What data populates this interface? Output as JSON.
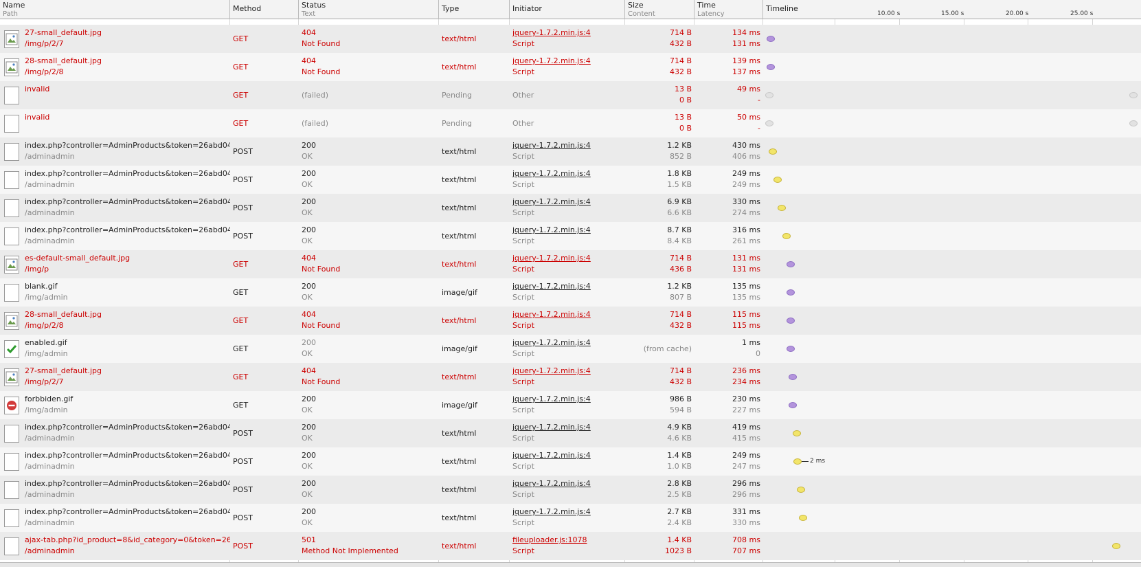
{
  "headers": {
    "name": "Name",
    "path": "Path",
    "method": "Method",
    "status": "Status",
    "text": "Text",
    "type": "Type",
    "initiator": "Initiator",
    "size": "Size",
    "content": "Content",
    "time": "Time",
    "latency": "Latency",
    "timeline": "Timeline"
  },
  "ticks": [
    "10.00 s",
    "15.00 s",
    "20.00 s",
    "25.00 s"
  ],
  "timeline_annotation": "2 ms",
  "rows": [
    {
      "icon": "broken-image-icon",
      "name": "27-small_default.jpg",
      "path": "/img/p/2/7",
      "method": "GET",
      "status": "404",
      "status_text": "Not Found",
      "type": "text/html",
      "initiator": "jquery-1.7.2.min.js:4",
      "initiator_type": "Script",
      "size": "714 B",
      "content": "432 B",
      "time": "134 ms",
      "latency": "131 ms",
      "style": "red",
      "dot": "purple"
    },
    {
      "icon": "broken-image-icon",
      "name": "28-small_default.jpg",
      "path": "/img/p/2/8",
      "method": "GET",
      "status": "404",
      "status_text": "Not Found",
      "type": "text/html",
      "initiator": "jquery-1.7.2.min.js:4",
      "initiator_type": "Script",
      "size": "714 B",
      "content": "432 B",
      "time": "139 ms",
      "latency": "137 ms",
      "style": "red",
      "dot": "purple"
    },
    {
      "icon": "blank-file-icon",
      "name": "invalid",
      "path": "",
      "method": "GET",
      "status": "(failed)",
      "status_text": "",
      "type": "Pending",
      "initiator": "Other",
      "initiator_type": "",
      "size": "13 B",
      "content": "0 B",
      "time": "49 ms",
      "latency": "-",
      "style": "failed",
      "dot": "grey"
    },
    {
      "icon": "blank-file-icon",
      "name": "invalid",
      "path": "",
      "method": "GET",
      "status": "(failed)",
      "status_text": "",
      "type": "Pending",
      "initiator": "Other",
      "initiator_type": "",
      "size": "13 B",
      "content": "0 B",
      "time": "50 ms",
      "latency": "-",
      "style": "failed",
      "dot": "grey"
    },
    {
      "icon": "blank-file-icon",
      "name": "index.php?controller=AdminProducts&token=26abd04...",
      "path": "/adminadmin",
      "method": "POST",
      "status": "200",
      "status_text": "OK",
      "type": "text/html",
      "initiator": "jquery-1.7.2.min.js:4",
      "initiator_type": "Script",
      "size": "1.2 KB",
      "content": "852 B",
      "time": "430 ms",
      "latency": "406 ms",
      "style": "normal",
      "dot": "yellow"
    },
    {
      "icon": "blank-file-icon",
      "name": "index.php?controller=AdminProducts&token=26abd04...",
      "path": "/adminadmin",
      "method": "POST",
      "status": "200",
      "status_text": "OK",
      "type": "text/html",
      "initiator": "jquery-1.7.2.min.js:4",
      "initiator_type": "Script",
      "size": "1.8 KB",
      "content": "1.5 KB",
      "time": "249 ms",
      "latency": "249 ms",
      "style": "normal",
      "dot": "yellow"
    },
    {
      "icon": "blank-file-icon",
      "name": "index.php?controller=AdminProducts&token=26abd04...",
      "path": "/adminadmin",
      "method": "POST",
      "status": "200",
      "status_text": "OK",
      "type": "text/html",
      "initiator": "jquery-1.7.2.min.js:4",
      "initiator_type": "Script",
      "size": "6.9 KB",
      "content": "6.6 KB",
      "time": "330 ms",
      "latency": "274 ms",
      "style": "normal",
      "dot": "yellow"
    },
    {
      "icon": "blank-file-icon",
      "name": "index.php?controller=AdminProducts&token=26abd04...",
      "path": "/adminadmin",
      "method": "POST",
      "status": "200",
      "status_text": "OK",
      "type": "text/html",
      "initiator": "jquery-1.7.2.min.js:4",
      "initiator_type": "Script",
      "size": "8.7 KB",
      "content": "8.4 KB",
      "time": "316 ms",
      "latency": "261 ms",
      "style": "normal",
      "dot": "yellow"
    },
    {
      "icon": "broken-image-icon",
      "name": "es-default-small_default.jpg",
      "path": "/img/p",
      "method": "GET",
      "status": "404",
      "status_text": "Not Found",
      "type": "text/html",
      "initiator": "jquery-1.7.2.min.js:4",
      "initiator_type": "Script",
      "size": "714 B",
      "content": "436 B",
      "time": "131 ms",
      "latency": "131 ms",
      "style": "red",
      "dot": "purple"
    },
    {
      "icon": "blank-file-icon",
      "name": "blank.gif",
      "path": "/img/admin",
      "method": "GET",
      "status": "200",
      "status_text": "OK",
      "type": "image/gif",
      "initiator": "jquery-1.7.2.min.js:4",
      "initiator_type": "Script",
      "size": "1.2 KB",
      "content": "807 B",
      "time": "135 ms",
      "latency": "135 ms",
      "style": "normal",
      "dot": "purple"
    },
    {
      "icon": "broken-image-icon",
      "name": "28-small_default.jpg",
      "path": "/img/p/2/8",
      "method": "GET",
      "status": "404",
      "status_text": "Not Found",
      "type": "text/html",
      "initiator": "jquery-1.7.2.min.js:4",
      "initiator_type": "Script",
      "size": "714 B",
      "content": "432 B",
      "time": "115 ms",
      "latency": "115 ms",
      "style": "red",
      "dot": "purple"
    },
    {
      "icon": "checkmark-icon",
      "name": "enabled.gif",
      "path": "/img/admin",
      "method": "GET",
      "status": "200",
      "status_text": "OK",
      "type": "image/gif",
      "initiator": "jquery-1.7.2.min.js:4",
      "initiator_type": "Script",
      "size": "(from cache)",
      "content": "",
      "time": "1 ms",
      "latency": "0",
      "style": "cached",
      "dot": "purple"
    },
    {
      "icon": "broken-image-icon",
      "name": "27-small_default.jpg",
      "path": "/img/p/2/7",
      "method": "GET",
      "status": "404",
      "status_text": "Not Found",
      "type": "text/html",
      "initiator": "jquery-1.7.2.min.js:4",
      "initiator_type": "Script",
      "size": "714 B",
      "content": "432 B",
      "time": "236 ms",
      "latency": "234 ms",
      "style": "red",
      "dot": "purple"
    },
    {
      "icon": "forbidden-icon",
      "name": "forbbiden.gif",
      "path": "/img/admin",
      "method": "GET",
      "status": "200",
      "status_text": "OK",
      "type": "image/gif",
      "initiator": "jquery-1.7.2.min.js:4",
      "initiator_type": "Script",
      "size": "986 B",
      "content": "594 B",
      "time": "230 ms",
      "latency": "227 ms",
      "style": "normal",
      "dot": "purple"
    },
    {
      "icon": "blank-file-icon",
      "name": "index.php?controller=AdminProducts&token=26abd04...",
      "path": "/adminadmin",
      "method": "POST",
      "status": "200",
      "status_text": "OK",
      "type": "text/html",
      "initiator": "jquery-1.7.2.min.js:4",
      "initiator_type": "Script",
      "size": "4.9 KB",
      "content": "4.6 KB",
      "time": "419 ms",
      "latency": "415 ms",
      "style": "normal",
      "dot": "yellow"
    },
    {
      "icon": "blank-file-icon",
      "name": "index.php?controller=AdminProducts&token=26abd04...",
      "path": "/adminadmin",
      "method": "POST",
      "status": "200",
      "status_text": "OK",
      "type": "text/html",
      "initiator": "jquery-1.7.2.min.js:4",
      "initiator_type": "Script",
      "size": "1.4 KB",
      "content": "1.0 KB",
      "time": "249 ms",
      "latency": "247 ms",
      "style": "normal",
      "dot": "yellow",
      "annot": true
    },
    {
      "icon": "blank-file-icon",
      "name": "index.php?controller=AdminProducts&token=26abd04...",
      "path": "/adminadmin",
      "method": "POST",
      "status": "200",
      "status_text": "OK",
      "type": "text/html",
      "initiator": "jquery-1.7.2.min.js:4",
      "initiator_type": "Script",
      "size": "2.8 KB",
      "content": "2.5 KB",
      "time": "296 ms",
      "latency": "296 ms",
      "style": "normal",
      "dot": "yellow"
    },
    {
      "icon": "blank-file-icon",
      "name": "index.php?controller=AdminProducts&token=26abd04...",
      "path": "/adminadmin",
      "method": "POST",
      "status": "200",
      "status_text": "OK",
      "type": "text/html",
      "initiator": "jquery-1.7.2.min.js:4",
      "initiator_type": "Script",
      "size": "2.7 KB",
      "content": "2.4 KB",
      "time": "331 ms",
      "latency": "330 ms",
      "style": "normal",
      "dot": "yellow"
    },
    {
      "icon": "blank-file-icon",
      "name": "ajax-tab.php?id_product=8&id_category=0&token=26...",
      "path": "/adminadmin",
      "method": "POST",
      "status": "501",
      "status_text": "Method Not Implemented",
      "type": "text/html",
      "initiator": "fileuploader.js:1078",
      "initiator_type": "Script",
      "size": "1.4 KB",
      "content": "1023 B",
      "time": "708 ms",
      "latency": "707 ms",
      "style": "red",
      "dot": "yellow"
    }
  ],
  "colors": {
    "error": "#cc0000",
    "purple": "#b394dc",
    "yellow": "#f2e56a",
    "grey": "#e2e2e2"
  }
}
